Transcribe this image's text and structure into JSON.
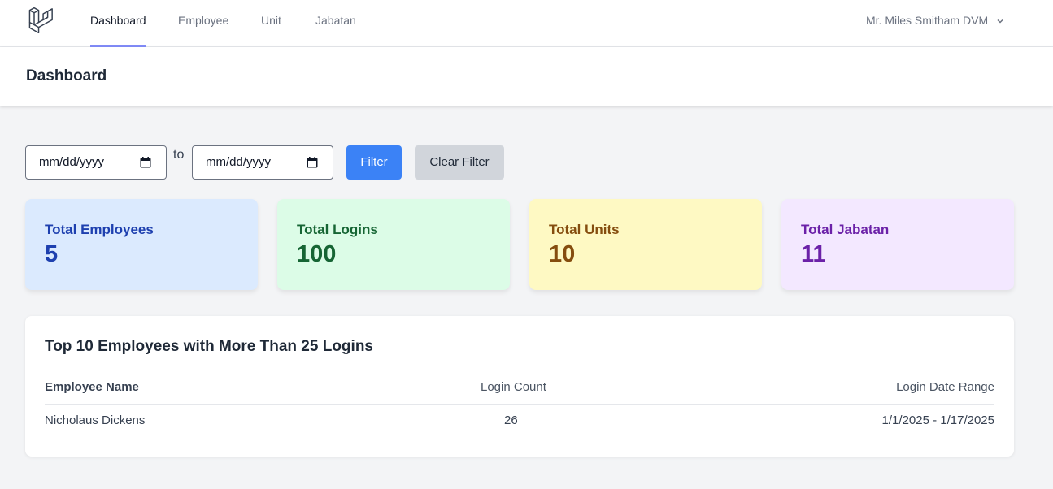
{
  "nav": {
    "logo_icon": "laravel-logo-icon",
    "links": [
      {
        "label": "Dashboard",
        "active": true
      },
      {
        "label": "Employee",
        "active": false
      },
      {
        "label": "Unit",
        "active": false
      },
      {
        "label": "Jabatan",
        "active": false
      }
    ],
    "user_name": "Mr. Miles Smitham DVM"
  },
  "header": {
    "title": "Dashboard"
  },
  "filter": {
    "start_date_placeholder": "mm/dd/yyyy",
    "to_label": "to",
    "end_date_placeholder": "mm/dd/yyyy",
    "filter_button": "Filter",
    "clear_button": "Clear Filter"
  },
  "stats": [
    {
      "label": "Total Employees",
      "value": "5",
      "bg": "#dbeafe",
      "color": "#1e40af"
    },
    {
      "label": "Total Logins",
      "value": "100",
      "bg": "#dcfce7",
      "color": "#166534"
    },
    {
      "label": "Total Units",
      "value": "10",
      "bg": "#fef9c3",
      "color": "#854d0e"
    },
    {
      "label": "Total Jabatan",
      "value": "11",
      "bg": "#f3e8ff",
      "color": "#6b21a8"
    }
  ],
  "top_employees": {
    "title": "Top 10 Employees with More Than 25 Logins",
    "columns": [
      "Employee Name",
      "Login Count",
      "Login Date Range"
    ],
    "rows": [
      {
        "name": "Nicholaus Dickens",
        "count": "26",
        "range": "1/1/2025 - 1/17/2025"
      }
    ]
  }
}
